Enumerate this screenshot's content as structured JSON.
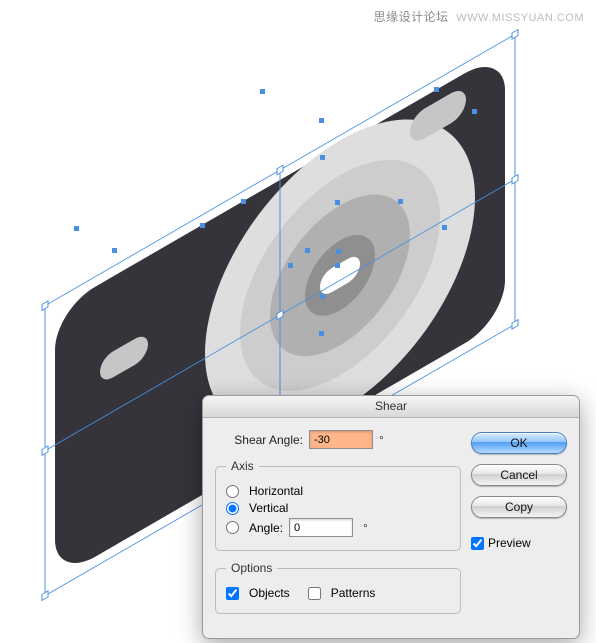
{
  "watermark": {
    "cn": "思缘设计论坛",
    "en": "WWW.MISSYUAN.COM"
  },
  "dialog": {
    "title": "Shear",
    "shear_angle_label": "Shear Angle:",
    "shear_angle_value": "-30",
    "degree": "°",
    "axis": {
      "legend": "Axis",
      "horizontal": "Horizontal",
      "vertical": "Vertical",
      "angle_label": "Angle:",
      "angle_value": "0"
    },
    "options": {
      "legend": "Options",
      "objects": "Objects",
      "patterns": "Patterns"
    },
    "buttons": {
      "ok": "OK",
      "cancel": "Cancel",
      "copy": "Copy"
    },
    "preview": "Preview"
  }
}
